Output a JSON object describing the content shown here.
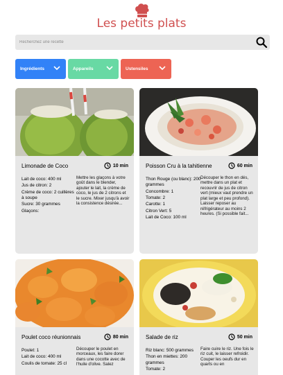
{
  "header": {
    "title": "Les petits plats",
    "logo_icon": "chef-hat-icon",
    "brand_color": "#D04F4F"
  },
  "search": {
    "placeholder": "Recherchez une recette",
    "value": "",
    "icon": "search-icon"
  },
  "filters": [
    {
      "label": "Ingrédients",
      "color": "#3282F7",
      "icon": "chevron-down-icon"
    },
    {
      "label": "Appareils",
      "color": "#68D9A4",
      "icon": "chevron-down-icon"
    },
    {
      "label": "Ustensiles",
      "color": "#ED6454",
      "icon": "chevron-down-icon"
    }
  ],
  "recipes": [
    {
      "title": "Limonade de Coco",
      "time": "10 min",
      "ingredients": [
        "Lait de coco: 400 ml",
        "Jus de citron: 2",
        "Crème de coco: 2 cuillères à soupe",
        "Sucre: 30 grammes",
        "Glaçons:"
      ],
      "description": "Mettre les glaçons à votre goût dans le blender, ajouter le lait, la crème de coco, le jus de 2 citrons et le sucre. Mixer jusqu'à avoir la consistence désirée..."
    },
    {
      "title": "Poisson Cru à la tahitienne",
      "time": "60 min",
      "ingredients": [
        "Thon Rouge (ou blanc): 200 grammes",
        "Concombre: 1",
        "Tomate: 2",
        "Carotte: 1",
        "Citron Vert: 5",
        "Lait de Coco: 100 ml"
      ],
      "description": "Découper le thon en dés, mettre dans un plat et recouvrir de jus de citron vert (mieux vaut prendre un plat large et peu profond). Laisser reposer au réfrigérateur au moins 2 heures. (Si possible fait..."
    },
    {
      "title": "Poulet coco réunionnais",
      "time": "80 min",
      "ingredients": [
        "Poulet: 1",
        "Lait de coco: 400 ml",
        "Coulis de tomate: 25 cl"
      ],
      "description": "Découper le poulet en morceaux, les faire dorer dans une cocotte avec de l'huile d'olive. Salez"
    },
    {
      "title": "Salade de riz",
      "time": "50 min",
      "ingredients": [
        "Riz blanc: 500 grammes",
        "Thon en miettes: 200 grammes",
        "Tomate: 2"
      ],
      "description": "Faire cuire le riz. Une fois le riz cuit, le laisser refroidir. Couper les oeufs dur en quarts ou en"
    }
  ]
}
